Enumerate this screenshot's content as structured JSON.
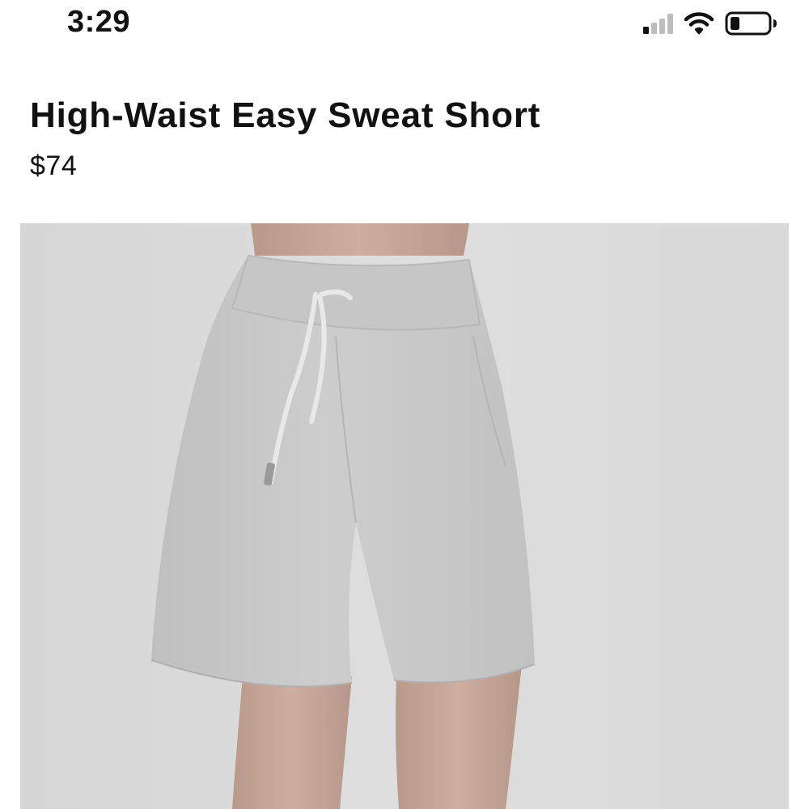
{
  "status_bar": {
    "time": "3:29",
    "signal_icon": "cellular-signal-icon",
    "wifi_icon": "wifi-icon",
    "battery_icon": "battery-icon",
    "battery_level": 0.2
  },
  "product": {
    "title": "High-Waist Easy Sweat Short",
    "price": "$74",
    "image_description_icon": "product-photo"
  },
  "colors": {
    "text": "#111111",
    "background": "#ffffff",
    "image_background": "#dcdcdc",
    "garment": "#c9c9c9"
  }
}
